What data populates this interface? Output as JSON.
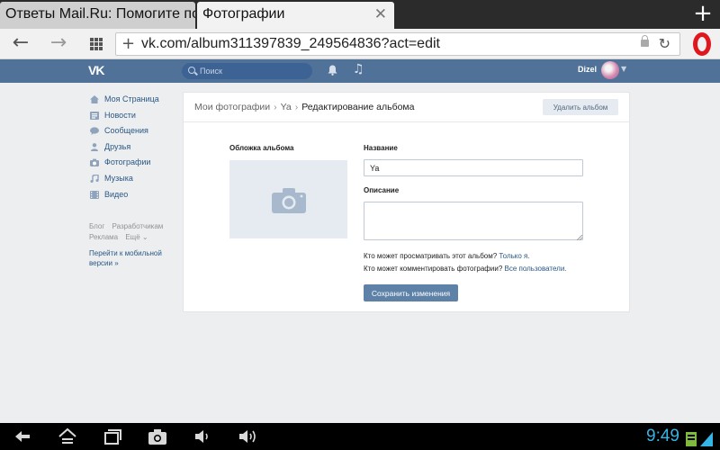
{
  "browser": {
    "tabs": [
      {
        "title": "Ответы Mail.Ru: Помогите пож",
        "active": false
      },
      {
        "title": "Фотографии",
        "active": true
      }
    ],
    "new_tab_icon": "plus-icon",
    "url": "vk.com/album311397839_249564836?act=edit"
  },
  "vk": {
    "header": {
      "logo": "VK",
      "search_placeholder": "Поиск",
      "user_name": "Dizel"
    },
    "menu": [
      {
        "label": "Моя Страница",
        "icon": "home-icon"
      },
      {
        "label": "Новости",
        "icon": "news-icon"
      },
      {
        "label": "Сообщения",
        "icon": "messages-icon"
      },
      {
        "label": "Друзья",
        "icon": "friends-icon"
      },
      {
        "label": "Фотографии",
        "icon": "camera-icon"
      },
      {
        "label": "Музыка",
        "icon": "music-icon"
      },
      {
        "label": "Видео",
        "icon": "video-icon"
      }
    ],
    "footer_links": [
      "Блог",
      "Разработчикам",
      "Реклама",
      "Ещё ⌄"
    ],
    "mobile_link": "Перейти к мобильной версии »",
    "breadcrumbs": {
      "root": "Мои фотографии",
      "album": "Ya",
      "current": "Редактирование альбома"
    },
    "delete_album_label": "Удалить альбом",
    "cover_label": "Обложка альбома",
    "name_label": "Название",
    "name_value": "Ya",
    "description_label": "Описание",
    "description_value": "",
    "view_privacy_text": "Кто может просматривать этот альбом?",
    "view_privacy_value": "Только я.",
    "comment_privacy_text": "Кто может комментировать фотографии?",
    "comment_privacy_value": "Все пользователи.",
    "save_label": "Сохранить изменения"
  },
  "system": {
    "clock": "9:49"
  },
  "colors": {
    "vk_header": "#507299",
    "link": "#2a5885",
    "save_button": "#5e81a8",
    "clock": "#35b5e5"
  }
}
